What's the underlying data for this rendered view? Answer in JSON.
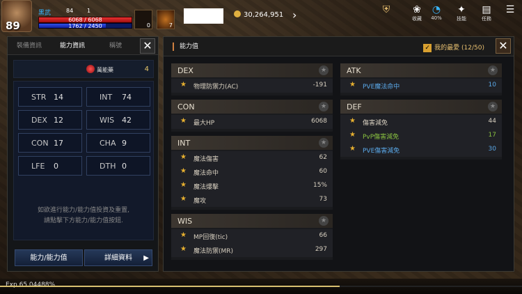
{
  "hud": {
    "level": "89",
    "name": "黑武",
    "small_a": "84",
    "small_b": "1",
    "hp_text": "6068 / 6068",
    "hp_ratio": 1.0,
    "mp_text": "1762 / 2450",
    "mp_ratio": 0.72,
    "slot1_count": "0",
    "slot2_count": "7",
    "gold": "30,264,951",
    "icons": [
      {
        "name": "armor-icon",
        "glyph": "⛨",
        "label": "",
        "color": "#e8c070"
      },
      {
        "name": "collect-icon",
        "glyph": "❀",
        "label": "收藏",
        "color": "#ffffff"
      },
      {
        "name": "battery-icon",
        "glyph": "◔",
        "label": "40%",
        "color": "#3ab6ff"
      },
      {
        "name": "skill-icon",
        "glyph": "✦",
        "label": "技能",
        "color": "#ffffff"
      },
      {
        "name": "quest-icon",
        "glyph": "▤",
        "label": "任務",
        "color": "#ffffff"
      },
      {
        "name": "menu-icon",
        "glyph": "☰",
        "label": "",
        "color": "#ffffff"
      }
    ]
  },
  "left": {
    "tabs": [
      "裝備資訊",
      "能力資訊",
      "稱號"
    ],
    "potion_label": "萬能藥",
    "potion_value": "4",
    "stats": [
      {
        "k": "STR",
        "v": "14"
      },
      {
        "k": "INT",
        "v": "74"
      },
      {
        "k": "DEX",
        "v": "12"
      },
      {
        "k": "WIS",
        "v": "42"
      },
      {
        "k": "CON",
        "v": "17"
      },
      {
        "k": "CHA",
        "v": "9"
      },
      {
        "k": "LFE",
        "v": "0"
      },
      {
        "k": "DTH",
        "v": "0"
      }
    ],
    "note_line1": "如欲進行能力/能力值投資及重置,",
    "note_line2": "請點擊下方能力/能力值按鈕.",
    "btn_ability": "能力/能力值",
    "btn_detail": "詳細資料"
  },
  "right": {
    "title": "能力值",
    "fav_label": "我的最愛 (12/50)",
    "left_cats": [
      {
        "name": "DEX",
        "rows": [
          {
            "n": "物理防禦力(AC)",
            "v": "-191",
            "c": ""
          }
        ]
      },
      {
        "name": "CON",
        "rows": [
          {
            "n": "最大HP",
            "v": "6068",
            "c": ""
          }
        ]
      },
      {
        "name": "INT",
        "rows": [
          {
            "n": "魔法傷害",
            "v": "62",
            "c": ""
          },
          {
            "n": "魔法命中",
            "v": "60",
            "c": ""
          },
          {
            "n": "魔法爆擊",
            "v": "15%",
            "c": ""
          },
          {
            "n": "魔攻",
            "v": "73",
            "c": ""
          }
        ]
      },
      {
        "name": "WIS",
        "rows": [
          {
            "n": "MP回復(tic)",
            "v": "66",
            "c": ""
          },
          {
            "n": "魔法防禦(MR)",
            "v": "297",
            "c": ""
          }
        ]
      }
    ],
    "right_cats": [
      {
        "name": "ATK",
        "rows": [
          {
            "n": "PVE魔法命中",
            "v": "10",
            "c": "blue"
          }
        ]
      },
      {
        "name": "DEF",
        "rows": [
          {
            "n": "傷害減免",
            "v": "44",
            "c": ""
          },
          {
            "n": "PvP傷害減免",
            "v": "17",
            "c": "green"
          },
          {
            "n": "PVE傷害減免",
            "v": "30",
            "c": "blue"
          }
        ]
      }
    ]
  },
  "bottom": {
    "exp": "Exp 65.04488%",
    "exp_ratio": 0.6504
  }
}
